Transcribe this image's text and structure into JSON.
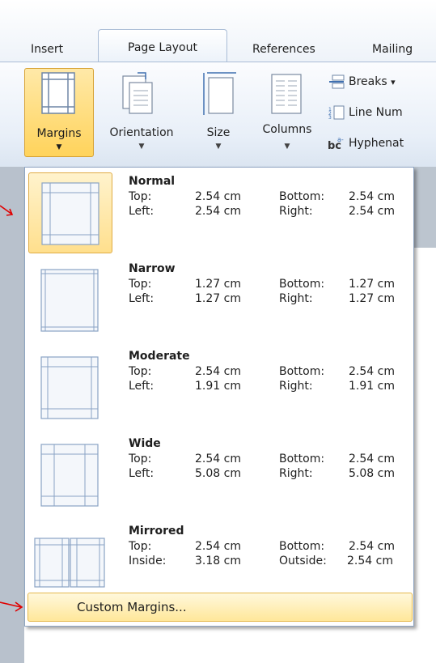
{
  "tabs": [
    {
      "label": "Insert"
    },
    {
      "label": "Page Layout"
    },
    {
      "label": "References"
    },
    {
      "label": "Mailing"
    }
  ],
  "ribbon": {
    "margins": "Margins",
    "orientation": "Orientation",
    "size": "Size",
    "columns": "Columns",
    "breaks": "Breaks",
    "breaks_arrow": "▾",
    "line_numbers": "Line Num",
    "hyphenation": "Hyphenat"
  },
  "menu": {
    "items": [
      {
        "name": "Normal",
        "r1": [
          "Top:",
          "2.54 cm",
          "Bottom:",
          "2.54 cm"
        ],
        "r2": [
          "Left:",
          "2.54 cm",
          "Right:",
          "2.54 cm"
        ]
      },
      {
        "name": "Narrow",
        "r1": [
          "Top:",
          "1.27 cm",
          "Bottom:",
          "1.27 cm"
        ],
        "r2": [
          "Left:",
          "1.27 cm",
          "Right:",
          "1.27 cm"
        ]
      },
      {
        "name": "Moderate",
        "r1": [
          "Top:",
          "2.54 cm",
          "Bottom:",
          "2.54 cm"
        ],
        "r2": [
          "Left:",
          "1.91 cm",
          "Right:",
          "1.91 cm"
        ]
      },
      {
        "name": "Wide",
        "r1": [
          "Top:",
          "2.54 cm",
          "Bottom:",
          "2.54 cm"
        ],
        "r2": [
          "Left:",
          "5.08 cm",
          "Right:",
          "5.08 cm"
        ]
      },
      {
        "name": "Mirrored",
        "r1": [
          "Top:",
          "2.54 cm",
          "Bottom:",
          "2.54 cm"
        ],
        "r2": [
          "Inside:",
          "3.18 cm",
          "Outside:",
          "2.54 cm"
        ]
      }
    ],
    "custom": "Custom Margins..."
  },
  "colors": {
    "highlight": "#ffd35b",
    "accent_red": "#e00000",
    "line_blue": "#8aa3c4"
  }
}
